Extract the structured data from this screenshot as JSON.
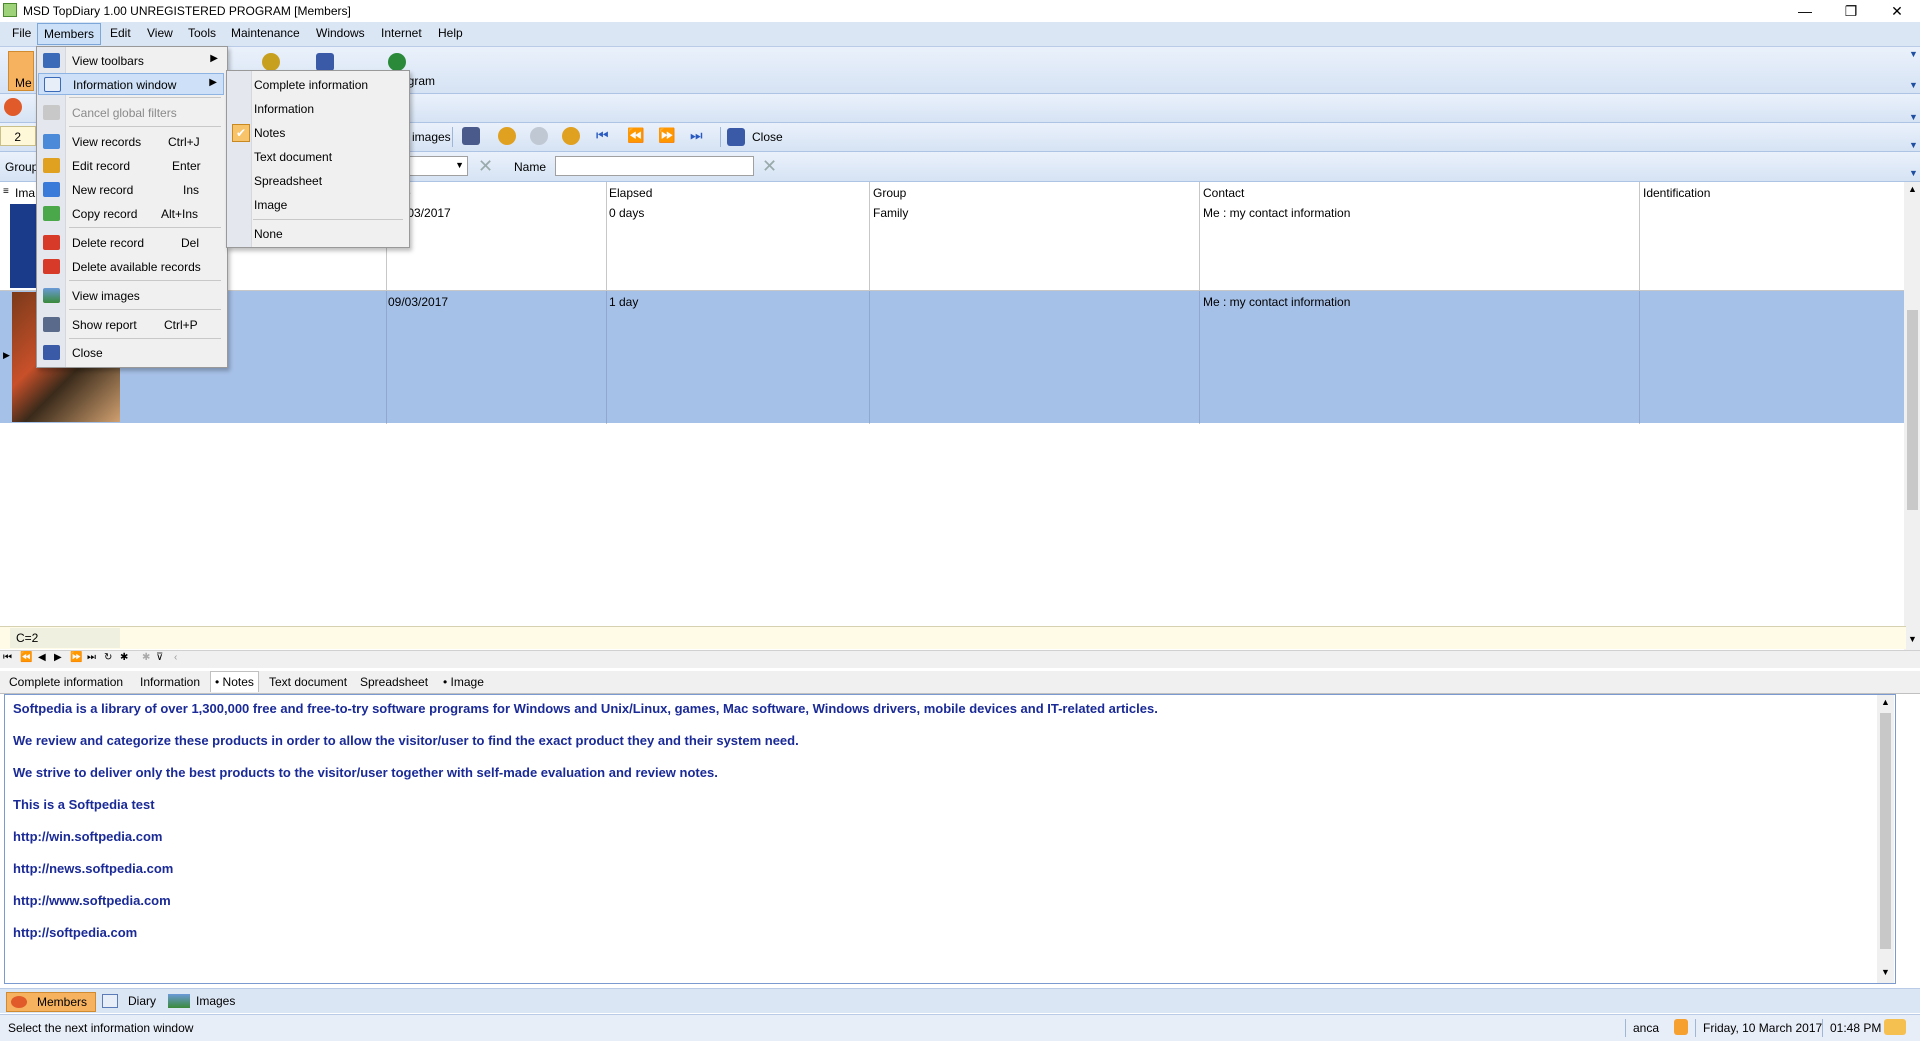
{
  "window": {
    "title": "MSD TopDiary 1.00 UNREGISTERED PROGRAM [Members]",
    "minimize": "—",
    "maximize": "❐",
    "close": "✕"
  },
  "menubar": [
    "File",
    "Members",
    "Edit",
    "View",
    "Tools",
    "Maintenance",
    "Windows",
    "Internet",
    "Help"
  ],
  "toolbar1": {
    "members_label": "Me",
    "program_label": "ogram"
  },
  "toolbar2": {
    "record_input": "2",
    "images_label": "images",
    "close_label": "Close"
  },
  "filterbar": {
    "group_label": "Group",
    "name_label": "Name",
    "name_value": ""
  },
  "grid": {
    "columns": [
      "Ima",
      "e",
      "Elapsed",
      "Group",
      "Contact",
      "Identification"
    ],
    "rows": [
      {
        "date": "/03/2017",
        "elapsed": "0 days",
        "group": "Family",
        "contact": "Me : my contact information",
        "identification": ""
      },
      {
        "date": "09/03/2017",
        "elapsed": "1 day",
        "group": "",
        "contact": "Me : my contact information",
        "identification": ""
      }
    ],
    "count": "C=2"
  },
  "members_menu": {
    "items": [
      {
        "label": "View toolbars",
        "shortcut": "",
        "submenu": true
      },
      {
        "label": "Information window",
        "shortcut": "",
        "submenu": true
      },
      {
        "label": "Cancel global filters",
        "shortcut": "",
        "disabled": true
      },
      {
        "label": "View records",
        "shortcut": "Ctrl+J"
      },
      {
        "label": "Edit record",
        "shortcut": "Enter"
      },
      {
        "label": "New record",
        "shortcut": "Ins"
      },
      {
        "label": "Copy record",
        "shortcut": "Alt+Ins"
      },
      {
        "label": "Delete record",
        "shortcut": "Del"
      },
      {
        "label": "Delete available records",
        "shortcut": ""
      },
      {
        "label": "View images",
        "shortcut": ""
      },
      {
        "label": "Show report",
        "shortcut": "Ctrl+P"
      },
      {
        "label": "Close",
        "shortcut": ""
      }
    ]
  },
  "info_submenu": {
    "items": [
      "Complete information",
      "Information",
      "Notes",
      "Text document",
      "Spreadsheet",
      "Image",
      "None"
    ],
    "checked": "Notes"
  },
  "info_tabs": [
    "Complete information",
    "Information",
    "• Notes",
    "Text document",
    "Spreadsheet",
    "• Image"
  ],
  "notes": [
    "Softpedia is a library of over 1,300,000 free and free-to-try software programs for Windows and Unix/Linux, games, Mac software, Windows drivers, mobile devices and IT-related articles.",
    "We review and categorize these products in order to allow the visitor/user to find the exact product they and their system need.",
    "We strive to deliver only the best products to the visitor/user together with self-made evaluation and review notes.",
    "This is a  Softpedia test",
    "http://win.softpedia.com",
    "http://news.softpedia.com",
    "http://www.softpedia.com",
    "http://softpedia.com"
  ],
  "bottom_tabs": [
    "Members",
    "Diary",
    "Images"
  ],
  "status": {
    "message": "Select the next information window",
    "user": "anca",
    "date": "Friday, 10 March 2017",
    "time": "01:48 PM"
  }
}
